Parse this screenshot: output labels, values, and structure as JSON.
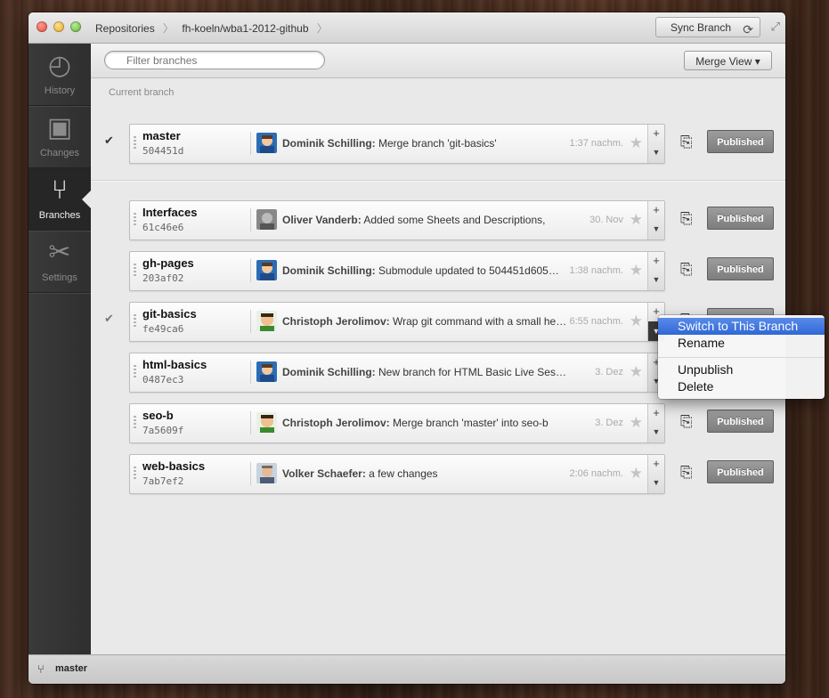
{
  "window": {
    "breadcrumb": [
      "Repositories",
      "fh-koeln/wba1-2012-github"
    ],
    "sync_label": "Sync Branch"
  },
  "sidebar": {
    "items": [
      {
        "label": "History",
        "icon": "history-icon"
      },
      {
        "label": "Changes",
        "icon": "changes-icon"
      },
      {
        "label": "Branches",
        "icon": "branches-icon",
        "active": true
      },
      {
        "label": "Settings",
        "icon": "settings-icon"
      }
    ]
  },
  "toolbar": {
    "filter_placeholder": "Filter branches",
    "merge_label": "Merge View"
  },
  "content": {
    "current_label": "Current branch"
  },
  "branches": [
    {
      "name": "master",
      "hash": "504451d",
      "author": "Dominik Schilling:",
      "message": "Merge branch 'git-basics'",
      "time": "1:37 nachm.",
      "checked": true,
      "publish": "Published"
    },
    {
      "name": "Interfaces",
      "hash": "61c46e6",
      "author": "Oliver Vanderb:",
      "message": "Added some Sheets and Descriptions,",
      "time": "30. Nov",
      "checked": false,
      "publish": "Published"
    },
    {
      "name": "gh-pages",
      "hash": "203af02",
      "author": "Dominik Schilling:",
      "message": "Submodule updated to 504451d605…",
      "time": "1:38 nachm.",
      "checked": false,
      "publish": "Published"
    },
    {
      "name": "git-basics",
      "hash": "fe49ca6",
      "author": "Christoph Jerolimov:",
      "message": "Wrap git command with a small he…",
      "time": "6:55 nachm.",
      "checked": true,
      "publish": "Published"
    },
    {
      "name": "html-basics",
      "hash": "0487ec3",
      "author": "Dominik Schilling:",
      "message": "New branch for HTML Basic Live Session",
      "time": "3. Dez",
      "checked": false,
      "publish": ""
    },
    {
      "name": "seo-b",
      "hash": "7a5609f",
      "author": "Christoph Jerolimov:",
      "message": "Merge branch 'master' into seo-b",
      "time": "3. Dez",
      "checked": false,
      "publish": "Published"
    },
    {
      "name": "web-basics",
      "hash": "7ab7ef2",
      "author": "Volker Schaefer:",
      "message": "a few changes",
      "time": "2:06 nachm.",
      "checked": false,
      "publish": "Published"
    }
  ],
  "context_menu": {
    "items": [
      "Switch to This Branch",
      "Rename",
      "Unpublish",
      "Delete"
    ]
  },
  "statusbar": {
    "branch": "master"
  }
}
